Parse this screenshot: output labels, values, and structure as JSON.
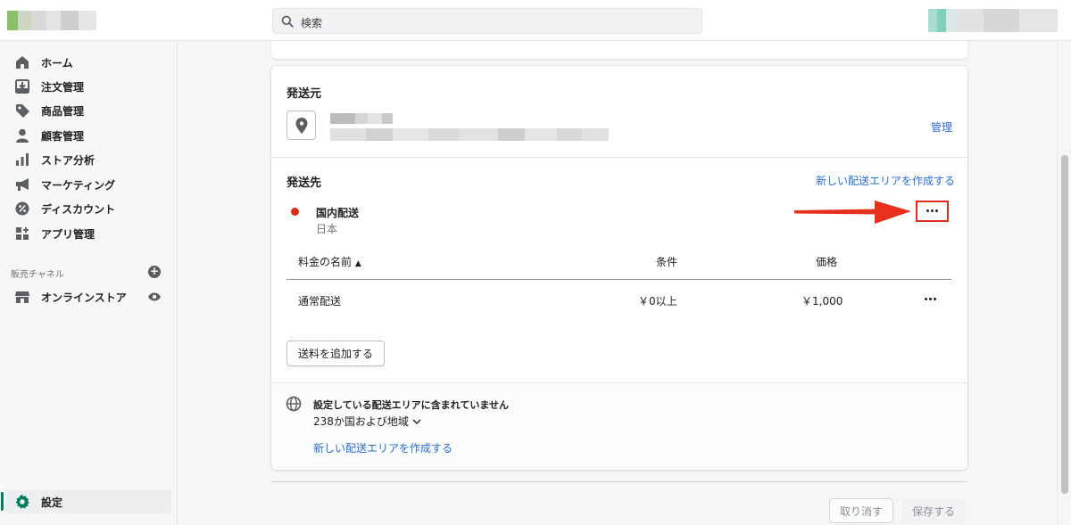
{
  "search": {
    "placeholder": "検索"
  },
  "sidebar": {
    "items": [
      {
        "label": "ホーム",
        "icon": "home-icon"
      },
      {
        "label": "注文管理",
        "icon": "orders-icon"
      },
      {
        "label": "商品管理",
        "icon": "tag-icon"
      },
      {
        "label": "顧客管理",
        "icon": "customer-icon"
      },
      {
        "label": "ストア分析",
        "icon": "analytics-icon"
      },
      {
        "label": "マーケティング",
        "icon": "megaphone-icon"
      },
      {
        "label": "ディスカウント",
        "icon": "discount-icon"
      },
      {
        "label": "アプリ管理",
        "icon": "apps-icon"
      }
    ],
    "channels_heading": "販売チャネル",
    "channels": [
      {
        "label": "オンラインストア",
        "icon": "store-icon"
      }
    ],
    "settings_label": "設定"
  },
  "shipping_origin": {
    "title": "発送元",
    "manage_link": "管理"
  },
  "shipping_to": {
    "title": "発送先",
    "create_zone_link": "新しい配送エリアを作成する",
    "zone": {
      "name": "国内配送",
      "country": "日本"
    },
    "table": {
      "headers": [
        "料金の名前",
        "条件",
        "価格"
      ],
      "rows": [
        {
          "name": "通常配送",
          "condition": "￥0以上",
          "price": "￥1,000"
        }
      ]
    },
    "add_rate_button": "送料を追加する"
  },
  "not_covered": {
    "title": "設定している配送エリアに含まれていません",
    "count": "238か国および地域",
    "create_zone_link": "新しい配送エリアを作成する"
  },
  "actions": {
    "cancel": "取り消す",
    "save": "保存する"
  },
  "colors": {
    "accent": "#008060",
    "link": "#2c6ecb",
    "annotation_red": "#e02e1f",
    "zone_dot": "#d72c0d"
  }
}
